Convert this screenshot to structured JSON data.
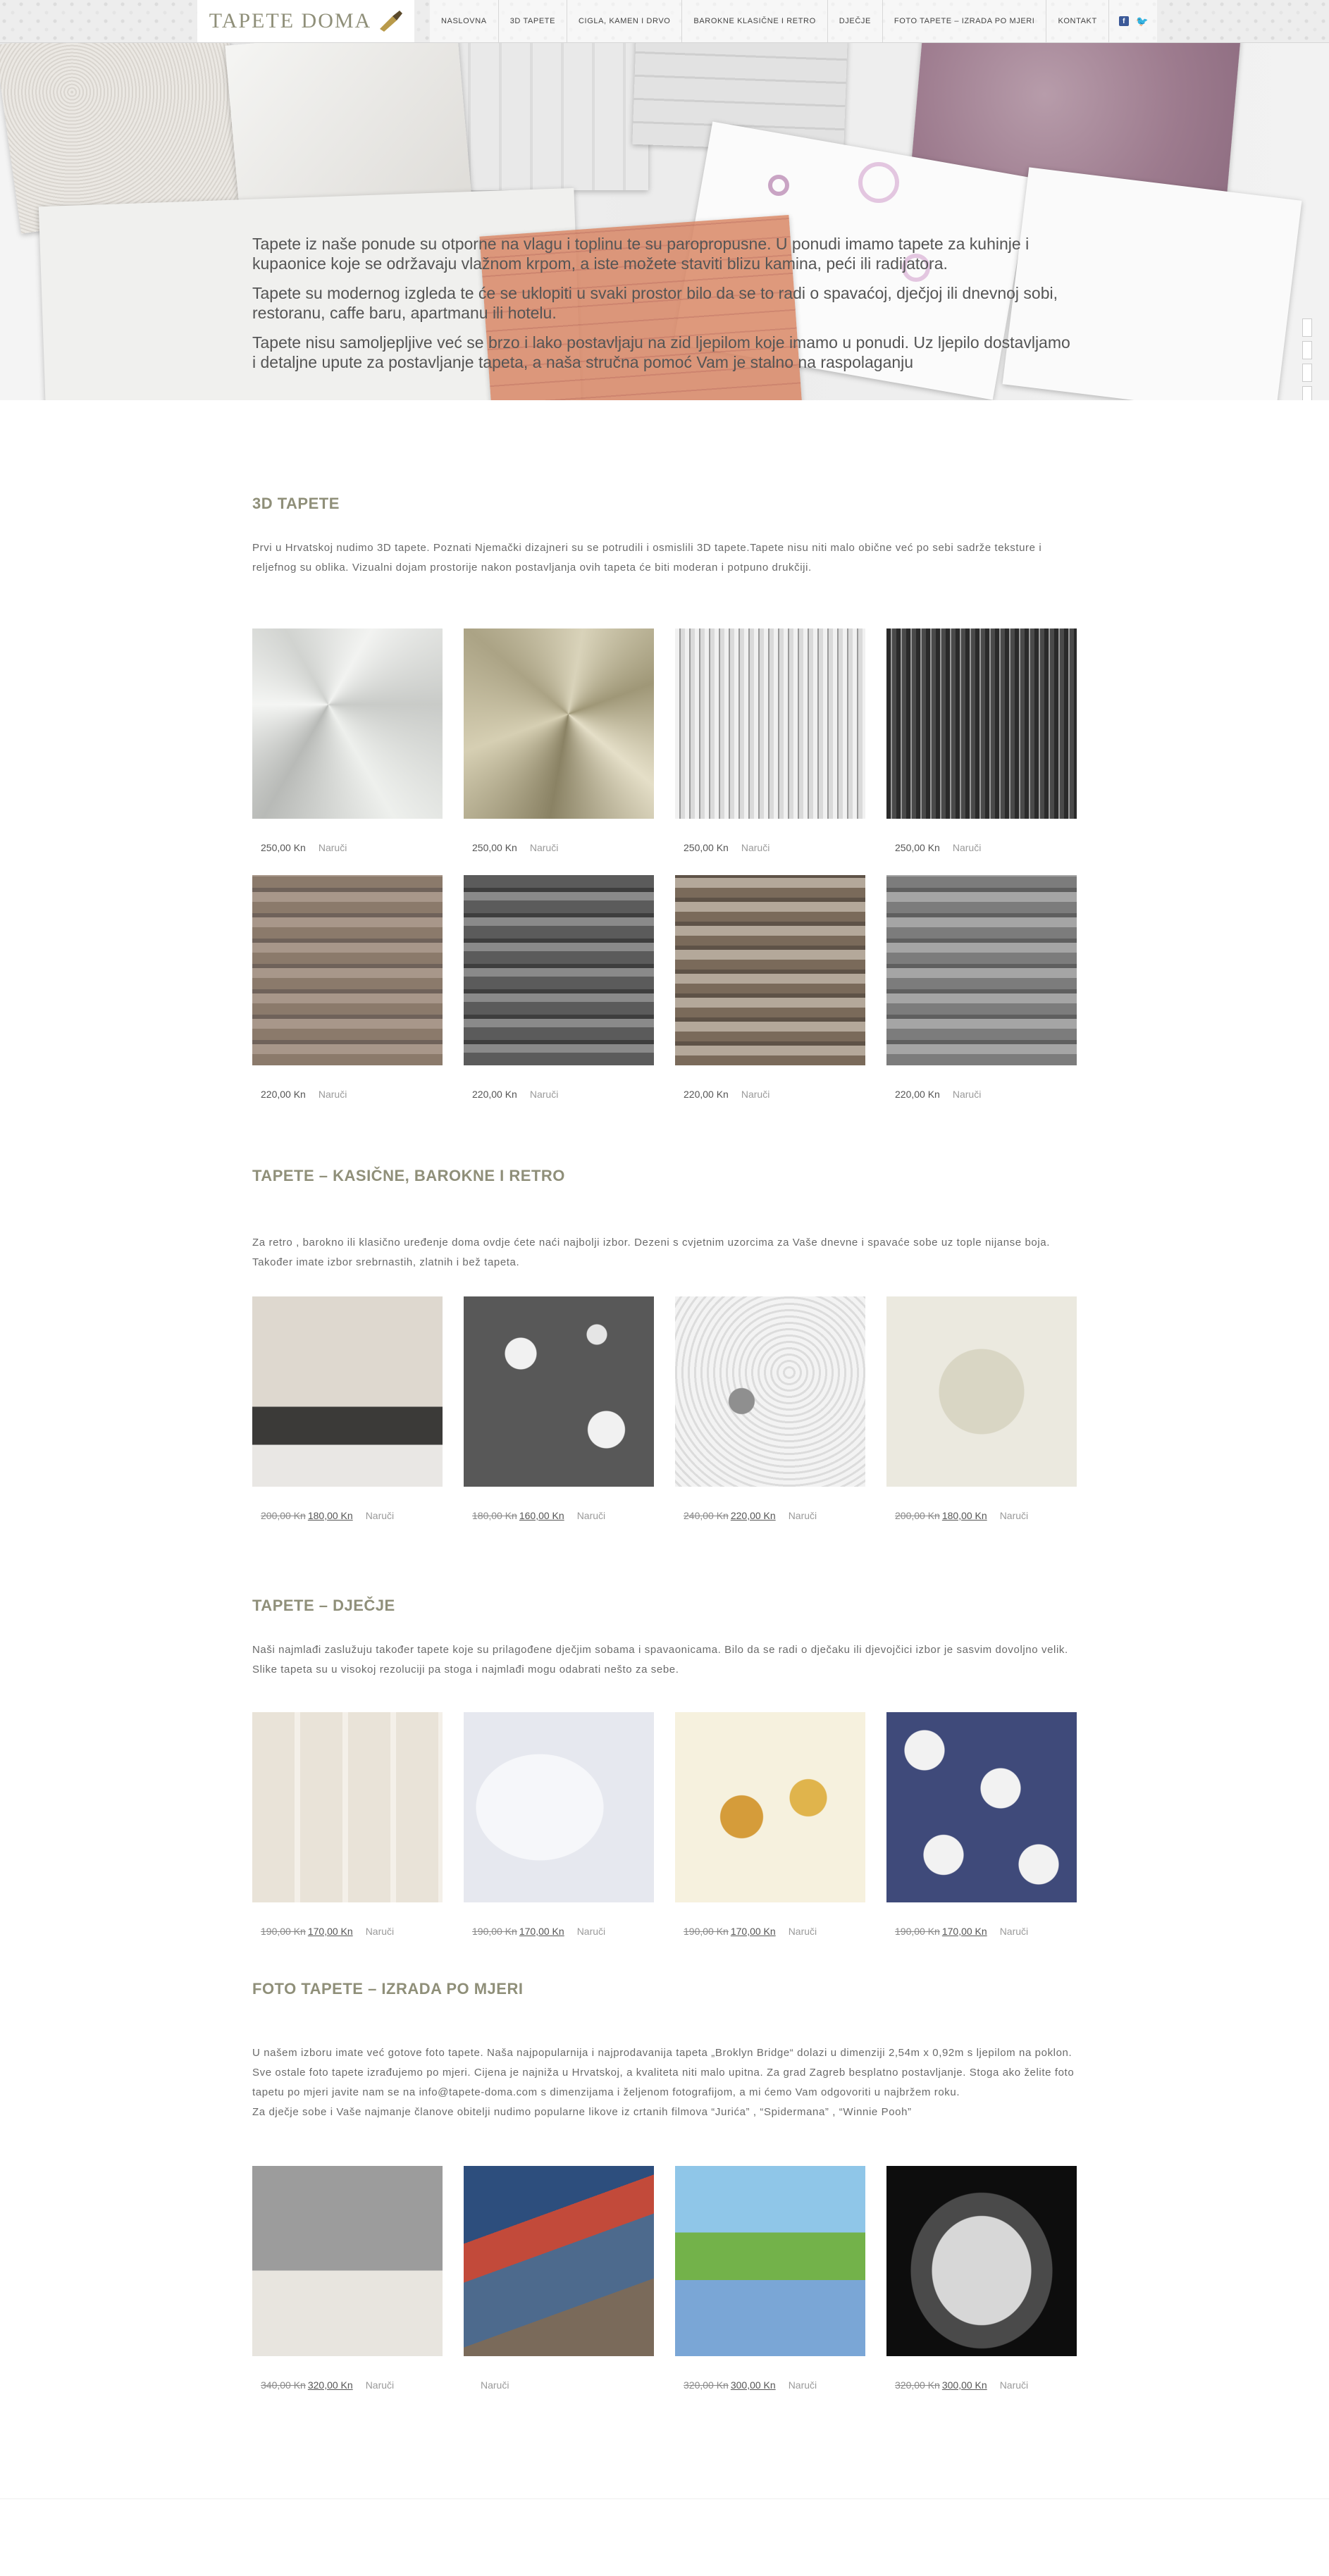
{
  "header": {
    "logo_text": "TAPETE DOMA",
    "nav": [
      "NASLOVNA",
      "3D TAPETE",
      "CIGLA, KAMEN I DRVO",
      "BAROKNE KLASIČNE I RETRO",
      "DJEČJE",
      "FOTO TAPETE – IZRADA PO MJERI",
      "KONTAKT"
    ],
    "social": {
      "facebook": "f",
      "twitter": "🐦"
    }
  },
  "hero": {
    "paragraphs": [
      "Tapete iz naše ponude su otporne na vlagu i toplinu te su paropropusne. U ponudi imamo tapete za kuhinje i kupaonice koje se održavaju vlažnom krpom, a iste možete staviti blizu kamina, peći ili radijatora.",
      "Tapete su modernog izgleda te će se uklopiti u svaki prostor bilo da se to radi o spavaćoj, dječjoj ili dnevnoj sobi, restoranu, caffe baru, apartmanu ili hotelu.",
      "Tapete nisu samoljepljive već se brzo i lako postavljaju na zid ljepilom koje imamo u ponudi. Uz ljepilo dostavljamo i detaljne upute za postavljanje tapeta, a naša stručna pomoć Vam je stalno na raspolaganju"
    ]
  },
  "order_label": "Naruči",
  "sections": {
    "s3d": {
      "title": "3D TAPETE",
      "desc": "Prvi u Hrvatskoj nudimo 3D tapete. Poznati Njemački dizajneri su se potrudili i osmislili 3D tapete.Tapete nisu niti malo obične već po sebi sadrže teksture i reljefnog su oblika. Vizualni dojam prostorije nakon postavljanja ovih tapeta će biti moderan i potpuno drukčiji.",
      "rows": [
        [
          {
            "price": "250,00 Kn"
          },
          {
            "price": "250,00 Kn"
          },
          {
            "price": "250,00 Kn"
          },
          {
            "price": "250,00 Kn"
          }
        ],
        [
          {
            "price": "220,00 Kn"
          },
          {
            "price": "220,00 Kn"
          },
          {
            "price": "220,00 Kn"
          },
          {
            "price": "220,00 Kn"
          }
        ]
      ]
    },
    "retro": {
      "title": "TAPETE – KASIČNE, BAROKNE I RETRO",
      "desc": "Za retro , barokno ili klasično uređenje doma ovdje ćete naći najbolji izbor. Dezeni s cvjetnim uzorcima za Vaše dnevne i spavaće sobe uz tople nijanse boja. Također imate izbor srebrnastih, zlatnih i bež tapeta.",
      "rows": [
        [
          {
            "old": "200,00 Kn",
            "new": "180,00 Kn"
          },
          {
            "old": "180,00 Kn",
            "new": "160,00 Kn"
          },
          {
            "old": "240,00 Kn",
            "new": "220,00 Kn"
          },
          {
            "old": "200,00 Kn",
            "new": "180,00 Kn"
          }
        ]
      ]
    },
    "kids": {
      "title": "TAPETE – DJEČJE",
      "desc": "Naši najmlađi zaslužuju također tapete koje su prilagođene dječjim sobama i spavaonicama. Bilo da se radi o dječaku ili djevojčici izbor je sasvim dovoljno velik. Slike tapeta su u visokoj rezoluciji pa stoga i najmlađi mogu odabrati nešto za sebe.",
      "rows": [
        [
          {
            "old": "190,00 Kn",
            "new": "170,00 Kn"
          },
          {
            "old": "190,00 Kn",
            "new": "170,00 Kn"
          },
          {
            "old": "190,00 Kn",
            "new": "170,00 Kn"
          },
          {
            "old": "190,00 Kn",
            "new": "170,00 Kn"
          }
        ]
      ]
    },
    "photo": {
      "title": "FOTO TAPETE – IZRADA PO MJERI",
      "desc_lines": [
        "U našem izboru imate već gotove foto tapete. Naša najpopularnija i najprodavanija tapeta „Broklyn Bridge“ dolazi u dimenziji 2,54m x 0,92m s ljepilom na poklon. Sve ostale foto tapete izrađujemo po mjeri. Cijena je najniža u Hrvatskoj, a kvaliteta niti malo upitna. Za grad Zagreb besplatno postavljanje. Stoga ako želite foto tapetu po mjeri javite nam se na info@tapete-doma.com s dimenzijama i željenom fotografijom, a mi ćemo Vam odgovoriti u najbržem roku.",
        "Za dječje sobe i Vaše najmanje članove obitelji nudimo popularne likove iz crtanih filmova “Jurića” , “Spidermana” , “Winnie Pooh”"
      ],
      "rows": [
        [
          {
            "old": "340,00 Kn",
            "new": "320,00 Kn"
          },
          {},
          {
            "old": "320,00 Kn",
            "new": "300,00 Kn"
          },
          {
            "old": "320,00 Kn",
            "new": "300,00 Kn"
          }
        ]
      ]
    }
  }
}
